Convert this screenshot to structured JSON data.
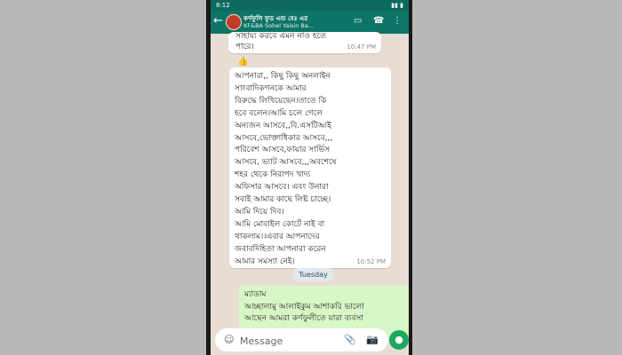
{
  "status_bar": {
    "time": "8:12",
    "indicators": "▮▮ ▮"
  },
  "header": {
    "back_icon": "arrow-left",
    "title": "কর্ণফুলি ফুড এন্ড বেঃ এর",
    "subtitle": "KF&BA Sohel Yaisin Ba...",
    "icons": [
      "video-icon",
      "call-icon",
      "menu-icon"
    ]
  },
  "messages": [
    {
      "text": "সাহায্য করবে এমন নাও হতে\nপারে।",
      "time": "10:47 PM"
    },
    {
      "text": "আপনারা,, কিছু কিছু অনলাইন\nসাংবাদিকগনকে আমার\nবিরুদ্ধে লিখিয়েছেন।তাতে কি\nহবে বলেন।আমি চলে গেলে\nঅন্যজন আসবে,,বি.এসটিআই\nআসবে,ভোক্তাধিকার আসবে,,,\nপরিবেশ আসবে,ফায়ার সার্ভিস\nআসবে, ভ্যাট আসবে,,,অবশেষে\nশহর থেকে নিরাপদ খাদ্য\nঅফিসার আসবে। এবং উনারা\nসবাই আমার কাছে লিষ্ট চাচ্ছে।\nআমি দিয়ে দিব।\nআমি মোবাইল কোর্টে নাই বা\nথাকলাম।।এবার আপনাদের\nজবাবদিহিতা আপনারা করেন\nআমার সমস্যা নেই।",
      "time": "10:52 PM"
    }
  ],
  "reaction": "👍",
  "date_chip": "Tuesday",
  "outgoing_message": "ম্যাডাম\nআচ্ছালামু আলাইকুম আশাকরি ভালো\nআছেন আমরা কর্ণফুলীতে যারা ব্যবসা",
  "input": {
    "placeholder": "Message"
  },
  "icons": {
    "emoji": "emoji-icon",
    "attach": "attach-icon",
    "camera": "camera-icon",
    "mic": "mic-icon"
  },
  "colors": {
    "header": "#0e7467",
    "chat_bg": "#e7ddd3",
    "outgoing": "#d8f7c6",
    "mic": "#1ea85f"
  }
}
